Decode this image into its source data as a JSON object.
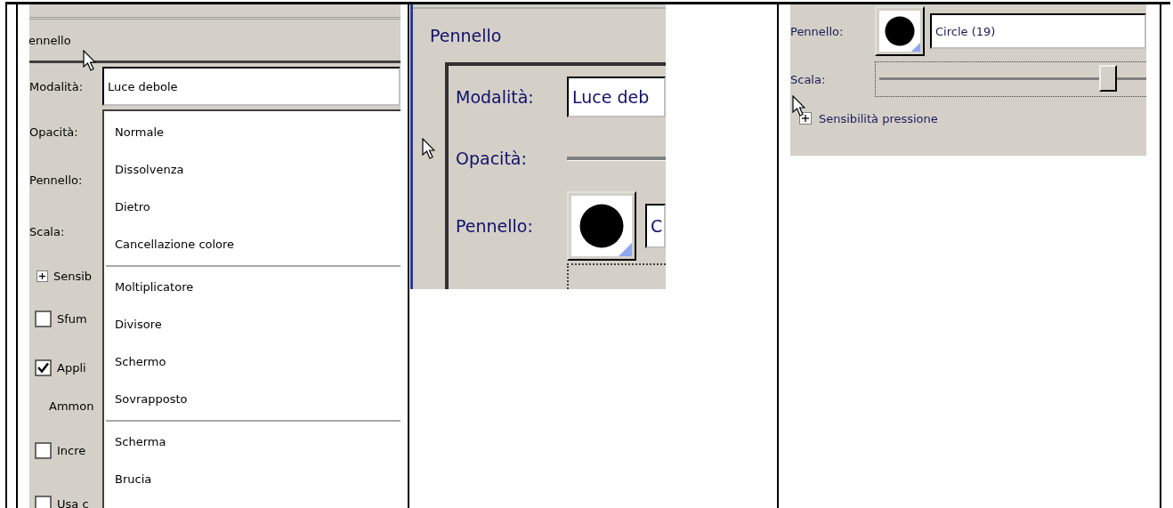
{
  "table": {
    "cells": [
      {
        "kind": "mode_menu",
        "heading": "ennello",
        "mode": {
          "label": "Modalità:",
          "value": "Luce debole"
        },
        "options": [
          {
            "kind": "text",
            "label": "Opacità:"
          },
          {
            "kind": "text",
            "label": "Pennello:"
          },
          {
            "kind": "text",
            "label": "Scala:"
          },
          {
            "kind": "expander",
            "label": "Sensib",
            "expanded": false
          },
          {
            "kind": "checkbox",
            "label": "Sfum",
            "checked": false
          },
          {
            "kind": "checkbox",
            "label": "Appli",
            "checked": true
          },
          {
            "kind": "indent",
            "label": "Ammon"
          },
          {
            "kind": "checkbox",
            "label": "Incre",
            "checked": false
          },
          {
            "kind": "checkbox",
            "label": "Usa c",
            "checked": false
          }
        ],
        "dropdown": {
          "groups": [
            [
              "Normale",
              "Dissolvenza",
              "Dietro",
              "Cancellazione colore"
            ],
            [
              "Moltiplicatore",
              "Divisore",
              "Schermo",
              "Sovrapposto"
            ],
            [
              "Scherma",
              "Brucia"
            ]
          ]
        }
      },
      {
        "kind": "zoomed_panel",
        "heading": "Pennello",
        "mode": {
          "label": "Modalità:",
          "value": "Luce deb"
        },
        "opacity": {
          "label": "Opacità:"
        },
        "brush": {
          "label": "Pennello:",
          "value": "C"
        }
      },
      {
        "kind": "brush_scale",
        "brush": {
          "label": "Pennello:",
          "value": "Circle (19)"
        },
        "scale": {
          "label": "Scala:",
          "level": 0.86
        },
        "pressure": {
          "label": "Sensibilità pressione",
          "expanded": false
        }
      }
    ]
  }
}
